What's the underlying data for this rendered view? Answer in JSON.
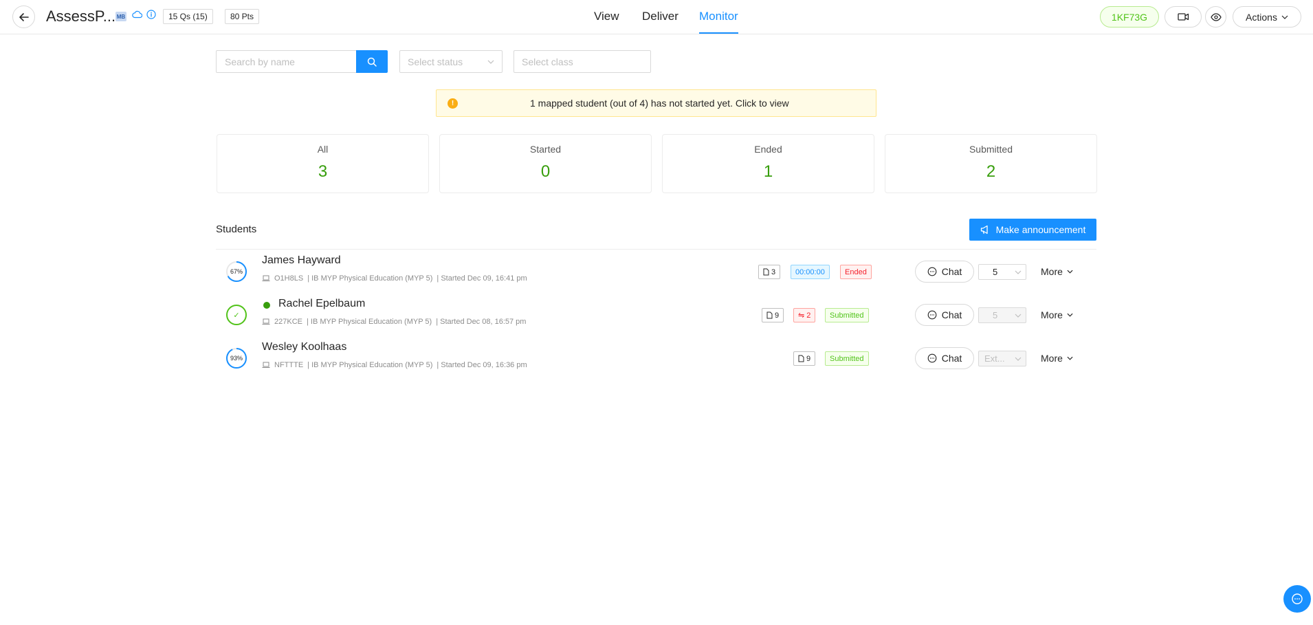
{
  "header": {
    "title": "AssessP...",
    "mb_badge": "MB",
    "questions": "15 Qs (15)",
    "points": "80 Pts",
    "tabs": [
      {
        "label": "View"
      },
      {
        "label": "Deliver"
      },
      {
        "label": "Monitor",
        "active": true
      }
    ],
    "code": "1KF73G",
    "actions_label": "Actions"
  },
  "filters": {
    "search_placeholder": "Search by name",
    "status_placeholder": "Select status",
    "class_placeholder": "Select class"
  },
  "alert": {
    "icon": "exclamation-icon",
    "text": "1 mapped student (out of 4) has not started yet. Click to view"
  },
  "stats": [
    {
      "label": "All",
      "value": "3"
    },
    {
      "label": "Started",
      "value": "0"
    },
    {
      "label": "Ended",
      "value": "1"
    },
    {
      "label": "Submitted",
      "value": "2"
    }
  ],
  "students_section": {
    "title": "Students",
    "announce_label": "Make announcement"
  },
  "students": [
    {
      "name": "James Hayward",
      "progress": "67%",
      "progress_fraction": 0.67,
      "code": "O1H8LS",
      "class": "| IB MYP Physical Education (MYP 5)",
      "started": "| Started Dec 09, 16:41 pm",
      "doc_count": "3",
      "timer": "00:00:00",
      "status": "Ended",
      "chat_label": "Chat",
      "select_value": "5",
      "more_label": "More"
    },
    {
      "name": "Rachel Epelbaum",
      "progress": "✓",
      "progress_fraction": 1,
      "online": true,
      "code": "227KCE",
      "class": "| IB MYP Physical Education (MYP 5)",
      "started": "| Started Dec 08, 16:57 pm",
      "doc_count": "9",
      "switch_count": "2",
      "status": "Submitted",
      "chat_label": "Chat",
      "select_value": "5",
      "more_label": "More"
    },
    {
      "name": "Wesley Koolhaas",
      "progress": "93%",
      "progress_fraction": 0.93,
      "code": "NFTTTE",
      "class": "| IB MYP Physical Education (MYP 5)",
      "started": "| Started Dec 09, 16:36 pm",
      "doc_count": "9",
      "status": "Submitted",
      "chat_label": "Chat",
      "select_value": "Ext...",
      "more_label": "More"
    }
  ],
  "colors": {
    "primary": "#1890ff",
    "success": "#389e0d",
    "danger": "#f5222d",
    "warning": "#faad14"
  }
}
